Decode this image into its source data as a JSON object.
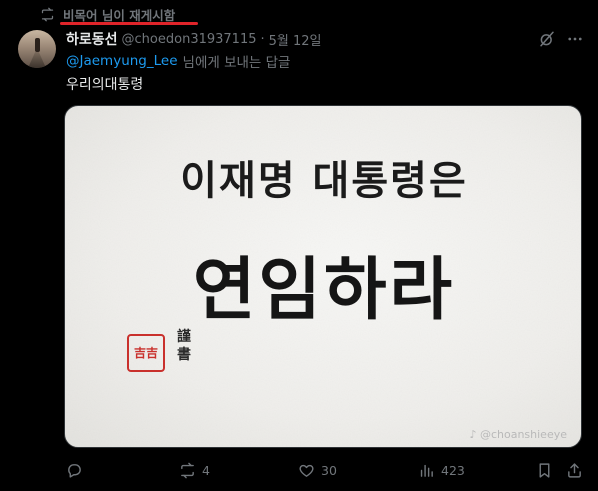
{
  "repost": {
    "text": "비목어 님이 재게시함"
  },
  "tweet": {
    "display_name": "하로동선",
    "handle": "@choedon31937115",
    "separator": "·",
    "date": "5월 12일",
    "reply_mention": "@Jaemyung_Lee",
    "reply_suffix": "님에게 보내는 답글",
    "text": "우리의대통령"
  },
  "media": {
    "line1": "이재명 대통령은",
    "line2": "연임하라",
    "seal_text": "吉吉",
    "signature": "謹書",
    "watermark": "♪ @choanshieeye"
  },
  "actions": {
    "reply_count": "",
    "repost_count": "4",
    "like_count": "30",
    "views_count": "423"
  },
  "colors": {
    "accent": "#1d9bf0",
    "muted": "#71767b",
    "text": "#e7e9ea",
    "highlight_underline": "#e0242a",
    "seal": "#c9302c"
  },
  "icons": [
    "repost-icon",
    "grok-icon",
    "more-icon",
    "reply-icon",
    "like-icon",
    "views-icon",
    "bookmark-icon",
    "share-icon"
  ]
}
